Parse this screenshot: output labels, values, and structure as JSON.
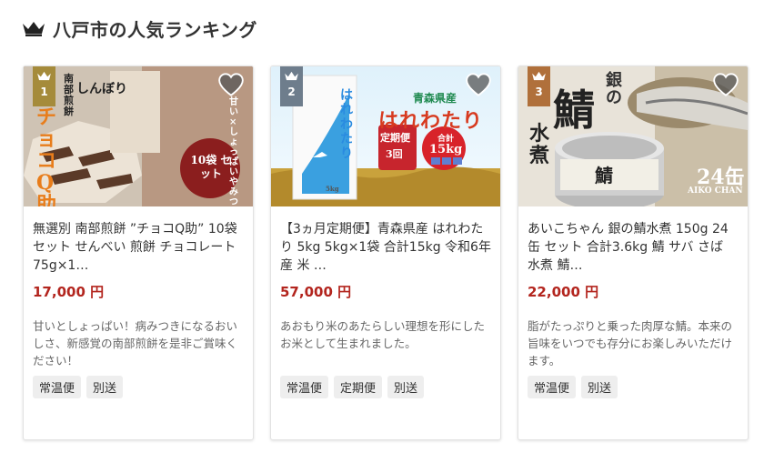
{
  "heading": {
    "title": "八戸市の人気ランキング",
    "icon": "crown-icon"
  },
  "colors": {
    "price": "#b3251e",
    "gold": "#a58b3b",
    "silver": "#6e7d8c",
    "bronze": "#b0703b"
  },
  "items": [
    {
      "rank": "1",
      "name": "無選別 南部煎餅 ”チョコQ助” 10袋セット せんべい 煎餅 チョコレート 75g×1…",
      "price": "17,000 円",
      "desc": "甘いとしょっぱい！病みつきになるおいしさ、新感覚の南部煎餅を是非ご賞味ください！",
      "tags": [
        "常温便",
        "別送"
      ],
      "image_text": {
        "maker": "しんぼり",
        "brand": "南部煎餅",
        "product": "チョコQ助",
        "copy": "甘い×しょっぱい やみつきになる美味しさ",
        "badge": "10袋 セット"
      }
    },
    {
      "rank": "2",
      "name": "【3ヵ月定期便】青森県産 はれわたり 5kg 5kg×1袋 合計15kg 令和6年産 米 …",
      "price": "57,000 円",
      "desc": "あおもり米のあたらしい理想を形にしたお米として生まれました。",
      "tags": [
        "常温便",
        "定期便",
        "別送"
      ],
      "image_text": {
        "region": "青森県産",
        "brand": "はれわたり",
        "bag": "はれわたり",
        "teiki": "定期便",
        "times": "3回",
        "total_label": "合計",
        "total": "15kg",
        "unit": "5kg"
      }
    },
    {
      "rank": "3",
      "name": "あいこちゃん 銀の鯖水煮 150g 24缶 セット 合計3.6kg 鯖 サバ さば 水煮 鯖…",
      "price": "22,000 円",
      "desc": "脂がたっぷりと乗った肉厚な鯖。本来の旨味をいつでも存分にお楽しみいただけます。",
      "tags": [
        "常温便",
        "別送"
      ],
      "image_text": {
        "gin": "銀の",
        "saba": "鯖",
        "mizuni": "水煮",
        "count": "24缶",
        "logo": "AIKO CHAN"
      }
    }
  ]
}
